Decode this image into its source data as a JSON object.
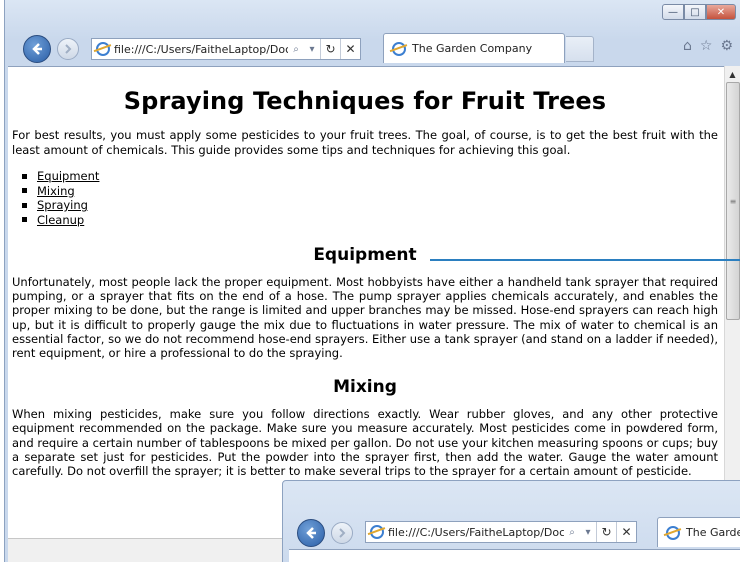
{
  "browser": {
    "address_url": "file:///C:/Users/FaitheLaptop/Docum",
    "tab_title": "The Garden Company",
    "caption": {
      "minimize": "—",
      "maximize": "□",
      "close": "✕"
    },
    "icons": [
      "back-arrow-icon",
      "forward-arrow-icon",
      "ie-logo-icon",
      "search-icon",
      "refresh-icon",
      "stop-icon",
      "home-icon",
      "favorites-star-icon",
      "tools-gear-icon"
    ]
  },
  "page": {
    "title": "Spraying Techniques for Fruit Trees",
    "intro": "For best results, you must apply some pesticides to your fruit trees. The goal, of course, is to get the best fruit with the least amount of chemicals. This guide provides some tips and techniques for achieving this goal.",
    "toc": [
      "Equipment",
      "Mixing",
      "Spraying",
      "Cleanup"
    ],
    "sections": [
      {
        "heading": "Equipment",
        "body": "Unfortunately, most people lack the proper equipment. Most hobbyists have either a handheld tank sprayer that required pumping, or a sprayer that fits on the end of a hose. The pump sprayer applies chemicals accurately, and enables the proper mixing to be done, but the range is limited and upper branches may be missed. Hose-end sprayers can reach high up, but it is difficult to properly gauge the mix due to fluctuations in water pressure. The mix of water to chemical is an essential factor, so we do not recommend hose-end sprayers. Either use a tank sprayer (and stand on a ladder if needed), rent equipment, or hire a professional to do the spraying."
      },
      {
        "heading": "Mixing",
        "body": "When mixing pesticides, make sure you follow directions exactly. Wear rubber gloves, and any other protective equipment recommended on the package. Make sure you measure accurately. Most pesticides come in powdered form, and require a certain number of tablespoons be mixed per gallon. Do not use your kitchen measuring spoons or cups; buy a separate set just for pesticides. Put the powder into the sprayer first, then add the water. Gauge the water amount carefully. Do not overfill the sprayer; it is better to make several trips to the sprayer for a certain amount of pesticide."
      }
    ]
  },
  "overlay_window": {
    "address_url": "file:///C:/Users/FaitheLaptop/Docum",
    "tab_title": "The Garden"
  },
  "colors": {
    "callout_line": "#2b7fc0",
    "chrome": "#c9d8ec"
  }
}
